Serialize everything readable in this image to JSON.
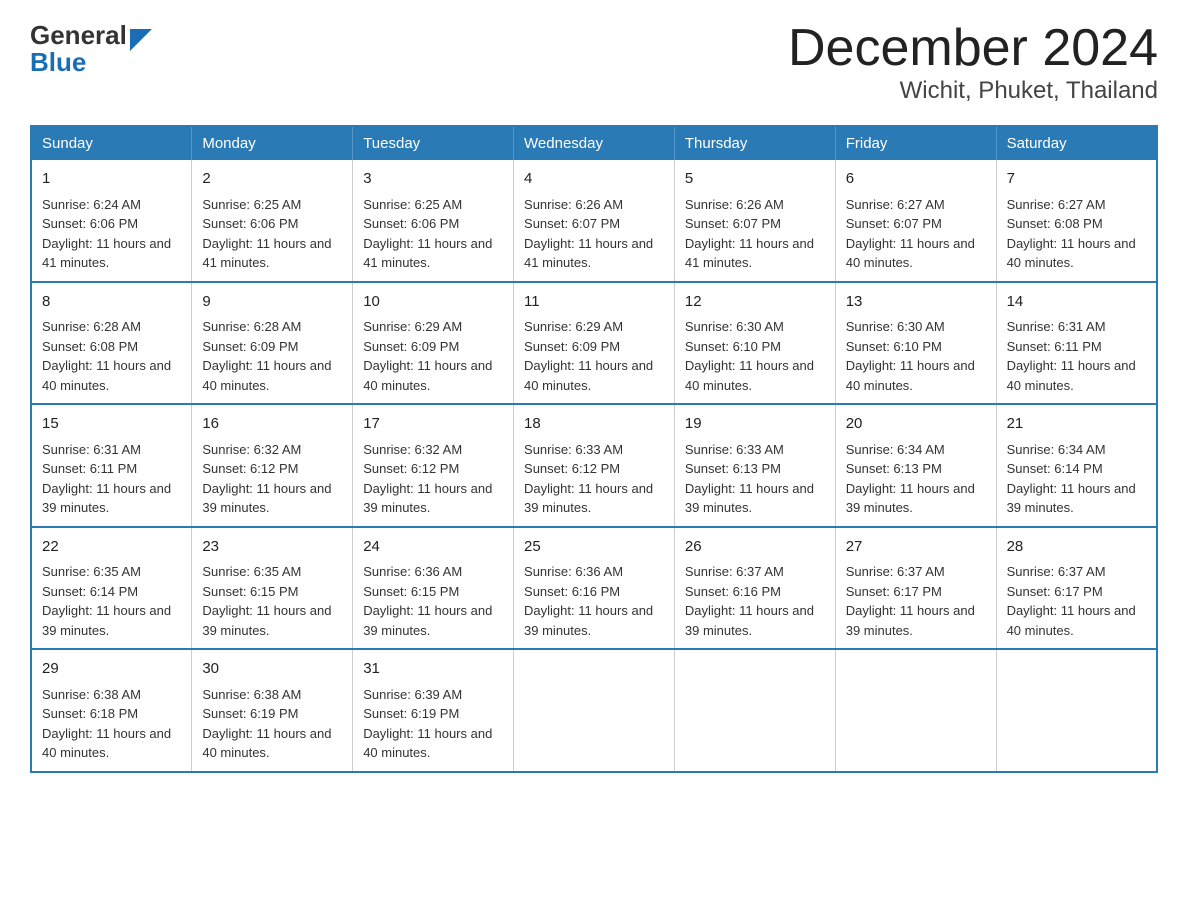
{
  "header": {
    "logo_general": "General",
    "logo_blue": "Blue",
    "month_title": "December 2024",
    "location": "Wichit, Phuket, Thailand"
  },
  "weekdays": [
    "Sunday",
    "Monday",
    "Tuesday",
    "Wednesday",
    "Thursday",
    "Friday",
    "Saturday"
  ],
  "weeks": [
    [
      {
        "day": "1",
        "sunrise": "6:24 AM",
        "sunset": "6:06 PM",
        "daylight": "11 hours and 41 minutes."
      },
      {
        "day": "2",
        "sunrise": "6:25 AM",
        "sunset": "6:06 PM",
        "daylight": "11 hours and 41 minutes."
      },
      {
        "day": "3",
        "sunrise": "6:25 AM",
        "sunset": "6:06 PM",
        "daylight": "11 hours and 41 minutes."
      },
      {
        "day": "4",
        "sunrise": "6:26 AM",
        "sunset": "6:07 PM",
        "daylight": "11 hours and 41 minutes."
      },
      {
        "day": "5",
        "sunrise": "6:26 AM",
        "sunset": "6:07 PM",
        "daylight": "11 hours and 41 minutes."
      },
      {
        "day": "6",
        "sunrise": "6:27 AM",
        "sunset": "6:07 PM",
        "daylight": "11 hours and 40 minutes."
      },
      {
        "day": "7",
        "sunrise": "6:27 AM",
        "sunset": "6:08 PM",
        "daylight": "11 hours and 40 minutes."
      }
    ],
    [
      {
        "day": "8",
        "sunrise": "6:28 AM",
        "sunset": "6:08 PM",
        "daylight": "11 hours and 40 minutes."
      },
      {
        "day": "9",
        "sunrise": "6:28 AM",
        "sunset": "6:09 PM",
        "daylight": "11 hours and 40 minutes."
      },
      {
        "day": "10",
        "sunrise": "6:29 AM",
        "sunset": "6:09 PM",
        "daylight": "11 hours and 40 minutes."
      },
      {
        "day": "11",
        "sunrise": "6:29 AM",
        "sunset": "6:09 PM",
        "daylight": "11 hours and 40 minutes."
      },
      {
        "day": "12",
        "sunrise": "6:30 AM",
        "sunset": "6:10 PM",
        "daylight": "11 hours and 40 minutes."
      },
      {
        "day": "13",
        "sunrise": "6:30 AM",
        "sunset": "6:10 PM",
        "daylight": "11 hours and 40 minutes."
      },
      {
        "day": "14",
        "sunrise": "6:31 AM",
        "sunset": "6:11 PM",
        "daylight": "11 hours and 40 minutes."
      }
    ],
    [
      {
        "day": "15",
        "sunrise": "6:31 AM",
        "sunset": "6:11 PM",
        "daylight": "11 hours and 39 minutes."
      },
      {
        "day": "16",
        "sunrise": "6:32 AM",
        "sunset": "6:12 PM",
        "daylight": "11 hours and 39 minutes."
      },
      {
        "day": "17",
        "sunrise": "6:32 AM",
        "sunset": "6:12 PM",
        "daylight": "11 hours and 39 minutes."
      },
      {
        "day": "18",
        "sunrise": "6:33 AM",
        "sunset": "6:12 PM",
        "daylight": "11 hours and 39 minutes."
      },
      {
        "day": "19",
        "sunrise": "6:33 AM",
        "sunset": "6:13 PM",
        "daylight": "11 hours and 39 minutes."
      },
      {
        "day": "20",
        "sunrise": "6:34 AM",
        "sunset": "6:13 PM",
        "daylight": "11 hours and 39 minutes."
      },
      {
        "day": "21",
        "sunrise": "6:34 AM",
        "sunset": "6:14 PM",
        "daylight": "11 hours and 39 minutes."
      }
    ],
    [
      {
        "day": "22",
        "sunrise": "6:35 AM",
        "sunset": "6:14 PM",
        "daylight": "11 hours and 39 minutes."
      },
      {
        "day": "23",
        "sunrise": "6:35 AM",
        "sunset": "6:15 PM",
        "daylight": "11 hours and 39 minutes."
      },
      {
        "day": "24",
        "sunrise": "6:36 AM",
        "sunset": "6:15 PM",
        "daylight": "11 hours and 39 minutes."
      },
      {
        "day": "25",
        "sunrise": "6:36 AM",
        "sunset": "6:16 PM",
        "daylight": "11 hours and 39 minutes."
      },
      {
        "day": "26",
        "sunrise": "6:37 AM",
        "sunset": "6:16 PM",
        "daylight": "11 hours and 39 minutes."
      },
      {
        "day": "27",
        "sunrise": "6:37 AM",
        "sunset": "6:17 PM",
        "daylight": "11 hours and 39 minutes."
      },
      {
        "day": "28",
        "sunrise": "6:37 AM",
        "sunset": "6:17 PM",
        "daylight": "11 hours and 40 minutes."
      }
    ],
    [
      {
        "day": "29",
        "sunrise": "6:38 AM",
        "sunset": "6:18 PM",
        "daylight": "11 hours and 40 minutes."
      },
      {
        "day": "30",
        "sunrise": "6:38 AM",
        "sunset": "6:19 PM",
        "daylight": "11 hours and 40 minutes."
      },
      {
        "day": "31",
        "sunrise": "6:39 AM",
        "sunset": "6:19 PM",
        "daylight": "11 hours and 40 minutes."
      },
      null,
      null,
      null,
      null
    ]
  ],
  "labels": {
    "sunrise_prefix": "Sunrise: ",
    "sunset_prefix": "Sunset: ",
    "daylight_prefix": "Daylight: "
  }
}
